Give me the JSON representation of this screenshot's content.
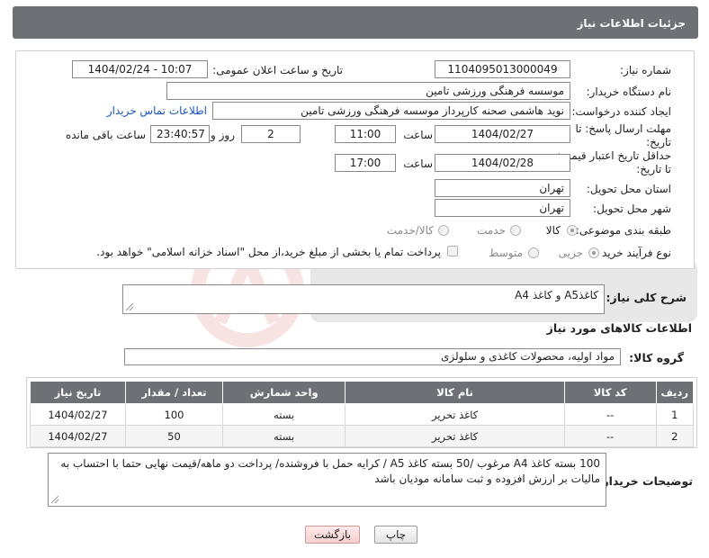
{
  "header": {
    "title": "جزئیات اطلاعات نیاز"
  },
  "form": {
    "need_number_label": "شماره نیاز:",
    "need_number": "1104095013000049",
    "announce_label": "تاریخ و ساعت اعلان عمومی:",
    "announce_value": "1404/02/24 - 10:07",
    "buyer_org_label": "نام دستگاه خریدار:",
    "buyer_org": "موسسه فرهنگی ورزشی تامین",
    "creator_label": "ایجاد کننده درخواست:",
    "creator": "نوید هاشمی صحنه کارپرداز موسسه فرهنگی ورزشی تامین",
    "contact_link": "اطلاعات تماس خریدار",
    "reply_deadline_label": "مهلت ارسال پاسخ: تا تاریخ:",
    "reply_date": "1404/02/27",
    "time_label": "ساعت",
    "reply_time": "11:00",
    "days_value": "2",
    "days_label": "روز و",
    "remaining_value": "23:40:57",
    "remaining_label": "ساعت باقی مانده",
    "price_validity_label": "حداقل تاریخ اعتبار قیمت: تا تاریخ:",
    "price_date": "1404/02/28",
    "price_time": "17:00",
    "province_label": "استان محل تحویل:",
    "province": "تهران",
    "city_label": "شهر محل تحویل:",
    "city": "تهران",
    "category_label": "طبقه بندی موضوعی:",
    "category_options": [
      "کالا",
      "خدمت",
      "کالا/خدمت"
    ],
    "process_label": "نوع فرآیند خرید :",
    "process_options": [
      "جزیی",
      "متوسط"
    ],
    "payment_note": "پرداخت تمام یا بخشی از مبلغ خرید،از محل \"اسناد خزانه اسلامی\" خواهد بود."
  },
  "summary": {
    "label": "شرح کلی نیاز:",
    "value": "کاغذA5 و کاغذ A4"
  },
  "goods_section": {
    "title": "اطلاعات کالاهای مورد نیاز",
    "group_label": "گروه کالا:",
    "group_value": "مواد اولیه، محصولات کاغذی و سلولزی"
  },
  "table": {
    "headers": [
      "ردیف",
      "کد کالا",
      "نام کالا",
      "واحد شمارش",
      "تعداد / مقدار",
      "تاریخ نیاز"
    ],
    "rows": [
      [
        "1",
        "--",
        "کاغذ تحریر",
        "بسته",
        "100",
        "1404/02/27"
      ],
      [
        "2",
        "--",
        "کاغذ تحریر",
        "بسته",
        "50",
        "1404/02/27"
      ]
    ]
  },
  "buyer_notes": {
    "label": "توضیحات خریدار:",
    "value": "100 بسته کاغذ A4 مرغوب /50 بسته کاغذ A5 / کرایه حمل با فروشنده/ پرداخت دو ماهه/قیمت نهایی حتما با احتساب به مالیات بر ارزش افزوده و ثبت سامانه مودیان باشد"
  },
  "buttons": {
    "print": "چاپ",
    "back": "بازگشت"
  },
  "colors": {
    "header_bg": "#6d7176",
    "link": "#1a56b8",
    "back_button": "#f6cfcf"
  }
}
